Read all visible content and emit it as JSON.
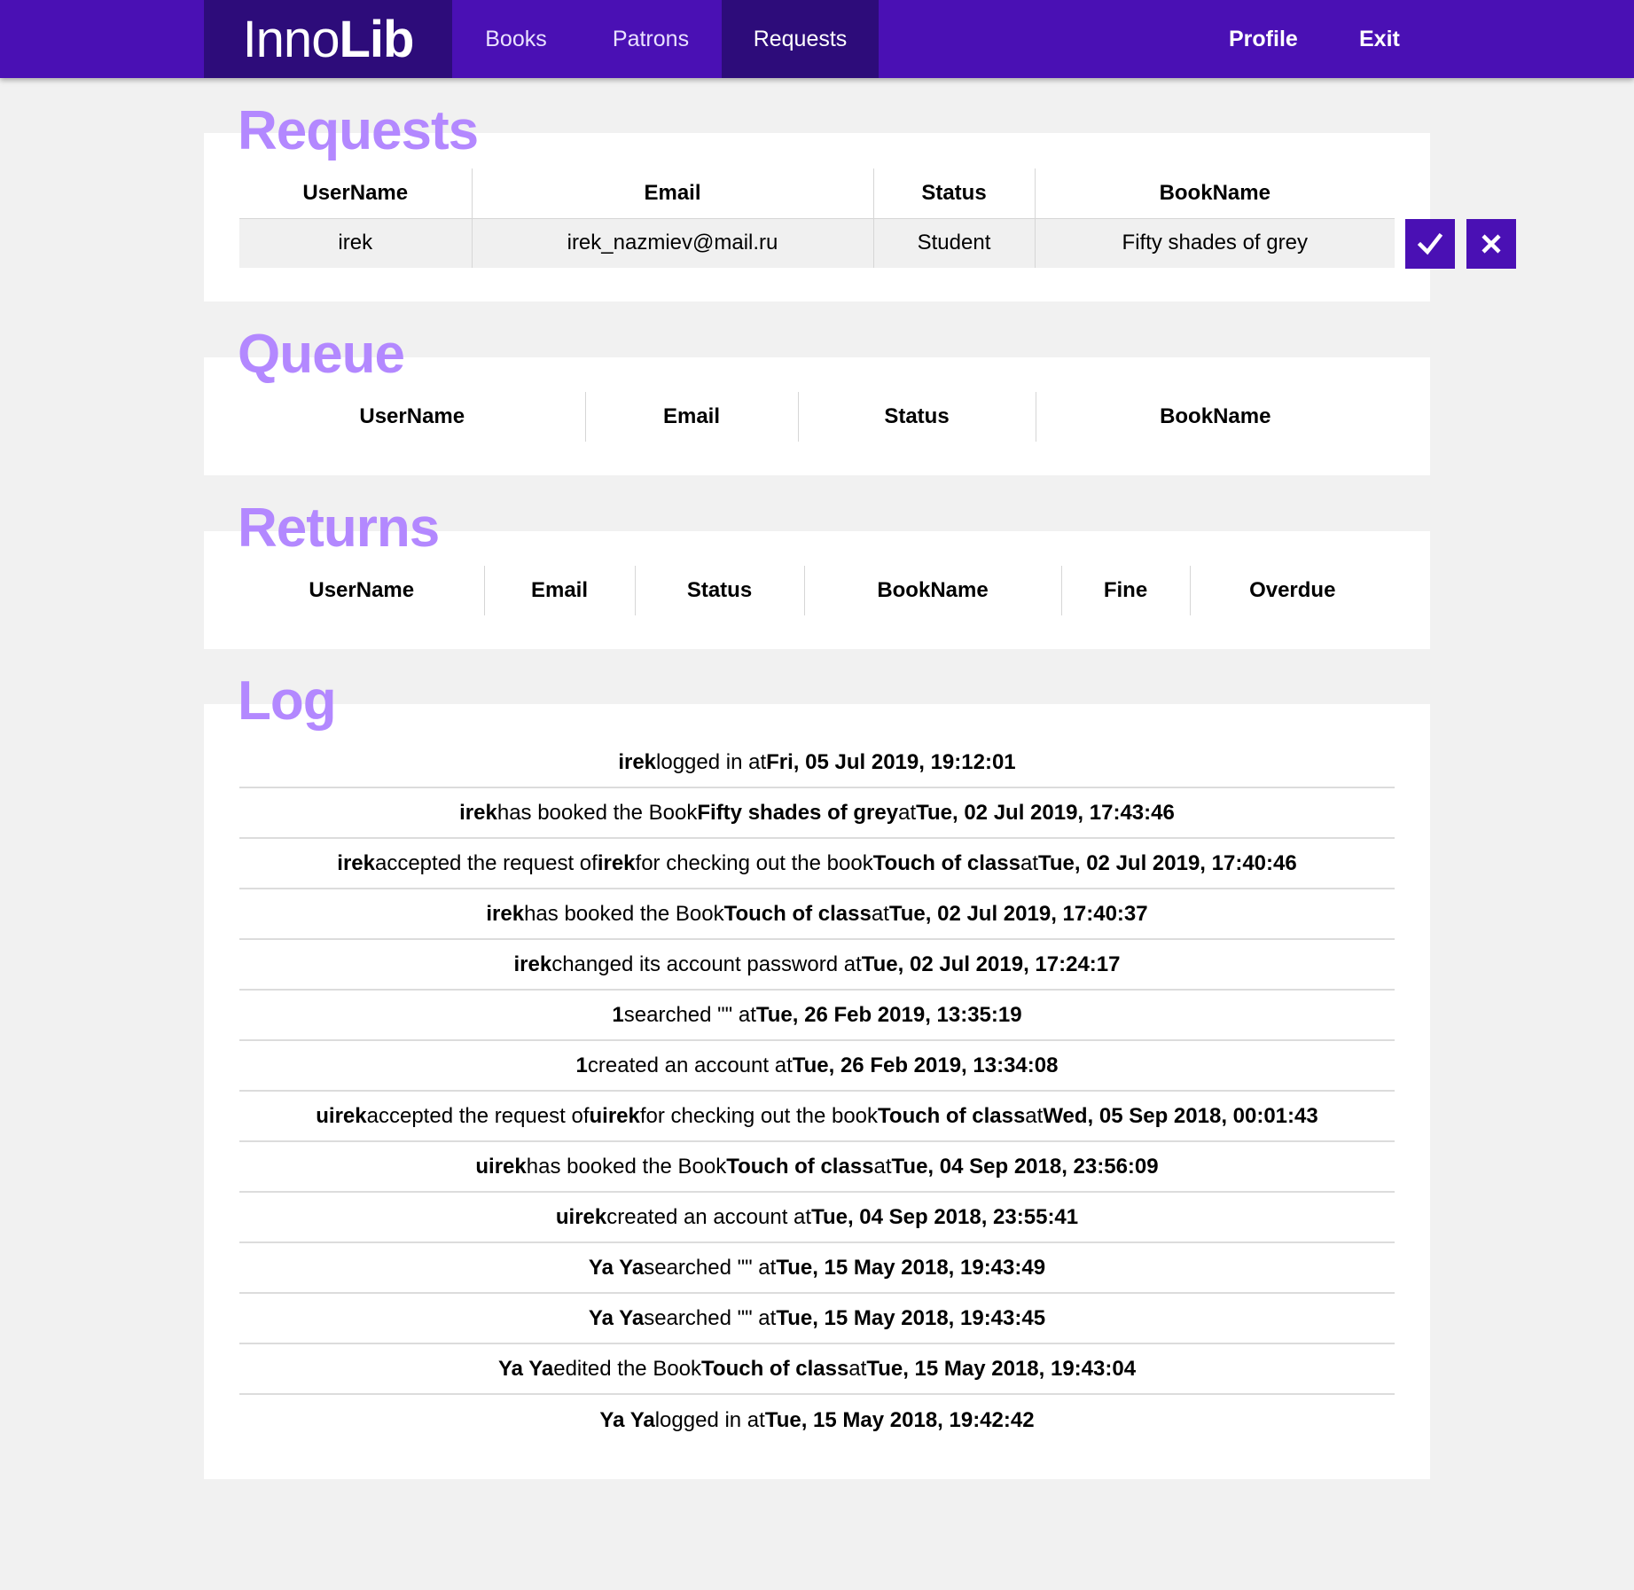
{
  "header": {
    "logo_thin": "Inno",
    "logo_bold": "Lib",
    "nav": [
      "Books",
      "Patrons",
      "Requests"
    ],
    "profile": "Profile",
    "exit": "Exit"
  },
  "requests": {
    "title": "Requests",
    "columns": [
      "UserName",
      "Email",
      "Status",
      "BookName"
    ],
    "rows": [
      {
        "username": "irek",
        "email": "irek_nazmiev@mail.ru",
        "status": "Student",
        "book": "Fifty shades of grey"
      }
    ]
  },
  "queue": {
    "title": "Queue",
    "columns": [
      "UserName",
      "Email",
      "Status",
      "BookName"
    ]
  },
  "returns": {
    "title": "Returns",
    "columns": [
      "UserName",
      "Email",
      "Status",
      "BookName",
      "Fine",
      "Overdue"
    ]
  },
  "log": {
    "title": "Log",
    "entries": [
      {
        "parts": [
          [
            "b",
            "irek"
          ],
          [
            "t",
            " logged in at "
          ],
          [
            "b",
            "Fri, 05 Jul 2019, 19:12:01"
          ]
        ]
      },
      {
        "parts": [
          [
            "b",
            "irek"
          ],
          [
            "t",
            " has booked the Book "
          ],
          [
            "b",
            "Fifty shades of grey"
          ],
          [
            "t",
            " at "
          ],
          [
            "b",
            "Tue, 02 Jul 2019, 17:43:46"
          ]
        ]
      },
      {
        "parts": [
          [
            "b",
            "irek"
          ],
          [
            "t",
            " accepted the request of "
          ],
          [
            "b",
            "irek"
          ],
          [
            "t",
            " for checking out the book "
          ],
          [
            "b",
            "Touch of class"
          ],
          [
            "t",
            " at "
          ],
          [
            "b",
            "Tue, 02 Jul 2019, 17:40:46"
          ]
        ]
      },
      {
        "parts": [
          [
            "b",
            "irek"
          ],
          [
            "t",
            " has booked the Book "
          ],
          [
            "b",
            "Touch of class"
          ],
          [
            "t",
            " at "
          ],
          [
            "b",
            "Tue, 02 Jul 2019, 17:40:37"
          ]
        ]
      },
      {
        "parts": [
          [
            "b",
            "irek"
          ],
          [
            "t",
            " changed its account password at "
          ],
          [
            "b",
            "Tue, 02 Jul 2019, 17:24:17"
          ]
        ]
      },
      {
        "parts": [
          [
            "b",
            "1"
          ],
          [
            "t",
            " searched \"\" at "
          ],
          [
            "b",
            "Tue, 26 Feb 2019, 13:35:19"
          ]
        ]
      },
      {
        "parts": [
          [
            "b",
            "1"
          ],
          [
            "t",
            " created an account at "
          ],
          [
            "b",
            "Tue, 26 Feb 2019, 13:34:08"
          ]
        ]
      },
      {
        "parts": [
          [
            "b",
            "uirek"
          ],
          [
            "t",
            " accepted the request of "
          ],
          [
            "b",
            "uirek"
          ],
          [
            "t",
            " for checking out the book "
          ],
          [
            "b",
            "Touch of class"
          ],
          [
            "t",
            " at "
          ],
          [
            "b",
            "Wed, 05 Sep 2018, 00:01:43"
          ]
        ]
      },
      {
        "parts": [
          [
            "b",
            "uirek"
          ],
          [
            "t",
            " has booked the Book "
          ],
          [
            "b",
            "Touch of class"
          ],
          [
            "t",
            " at "
          ],
          [
            "b",
            "Tue, 04 Sep 2018, 23:56:09"
          ]
        ]
      },
      {
        "parts": [
          [
            "b",
            "uirek"
          ],
          [
            "t",
            " created an account at "
          ],
          [
            "b",
            "Tue, 04 Sep 2018, 23:55:41"
          ]
        ]
      },
      {
        "parts": [
          [
            "b",
            "Ya Ya"
          ],
          [
            "t",
            " searched \"\" at "
          ],
          [
            "b",
            "Tue, 15 May 2018, 19:43:49"
          ]
        ]
      },
      {
        "parts": [
          [
            "b",
            "Ya Ya"
          ],
          [
            "t",
            " searched \"\" at "
          ],
          [
            "b",
            "Tue, 15 May 2018, 19:43:45"
          ]
        ]
      },
      {
        "parts": [
          [
            "b",
            "Ya Ya"
          ],
          [
            "t",
            " edited the Book "
          ],
          [
            "b",
            "Touch of class"
          ],
          [
            "t",
            " at "
          ],
          [
            "b",
            "Tue, 15 May 2018, 19:43:04"
          ]
        ]
      },
      {
        "parts": [
          [
            "b",
            "Ya Ya"
          ],
          [
            "t",
            " logged in at "
          ],
          [
            "b",
            "Tue, 15 May 2018, 19:42:42"
          ]
        ]
      }
    ]
  },
  "colors": {
    "header": "#4a10b4",
    "header_active": "#2d0c7a",
    "title_accent": "#b388ff",
    "button": "#4a10b4"
  },
  "icons": {
    "accept": "check-icon",
    "reject": "close-icon"
  }
}
